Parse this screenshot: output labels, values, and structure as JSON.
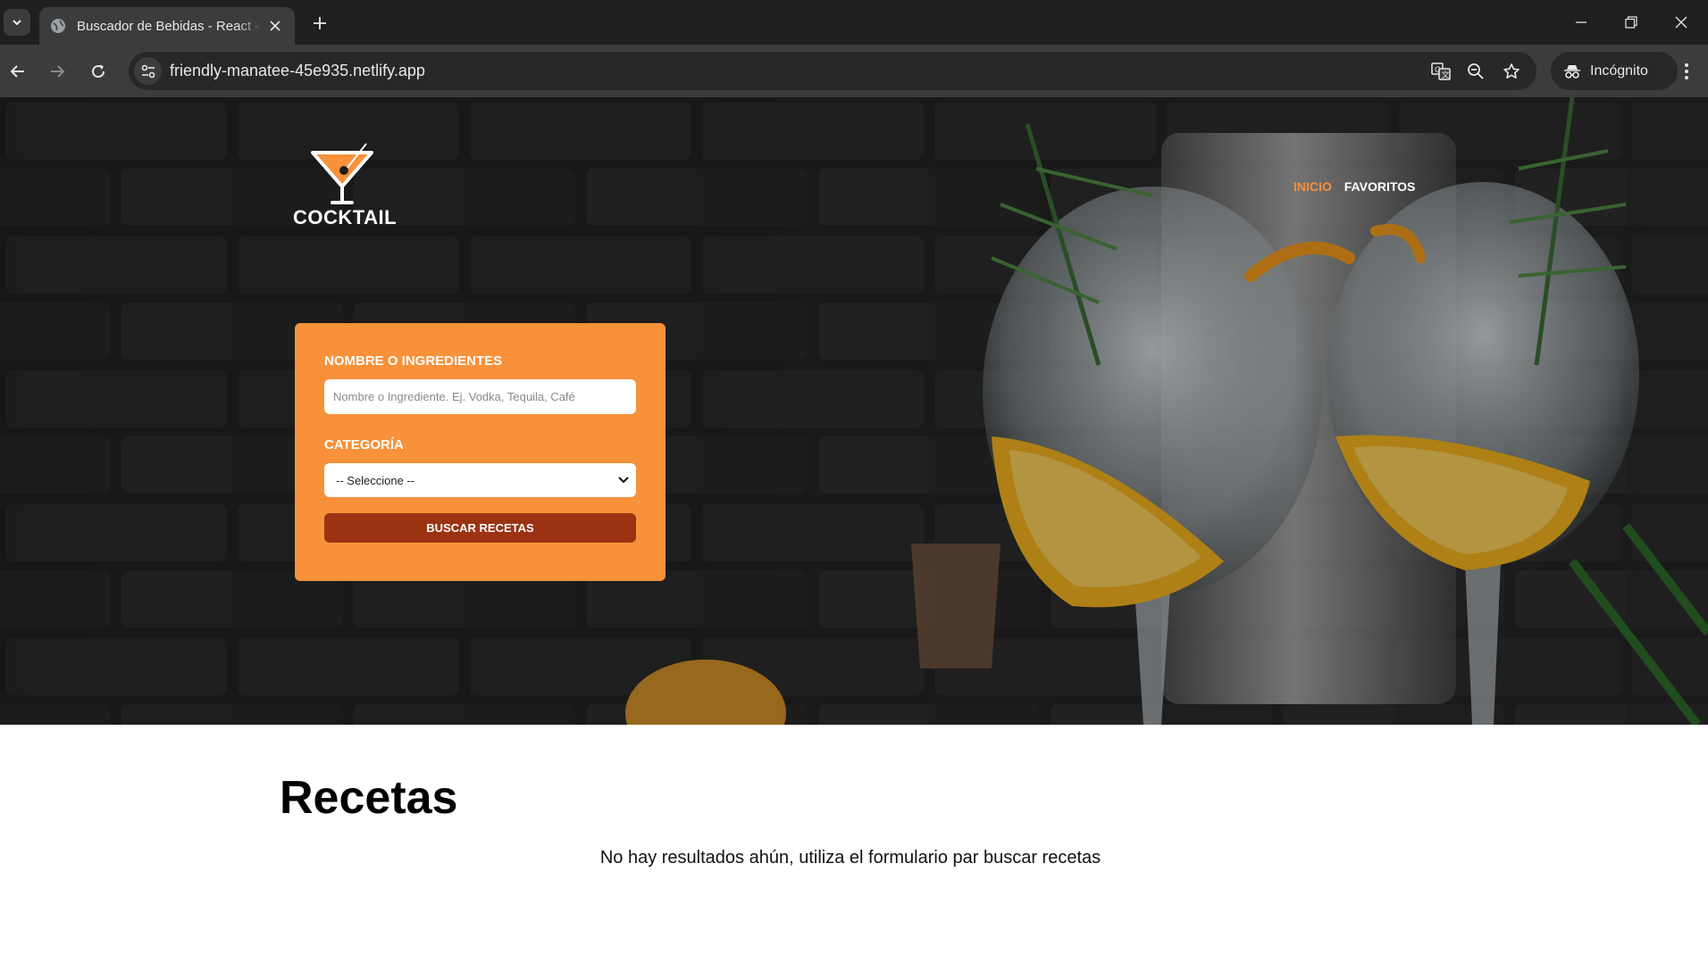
{
  "browser": {
    "tab_title": "Buscador de Bebidas - React - T",
    "url": "friendly-manatee-45e935.netlify.app",
    "incognito_label": "Incógnito",
    "icons": [
      "tab-search-icon",
      "globe-icon",
      "close-icon",
      "plus-icon",
      "minimize-icon",
      "restore-icon",
      "close-window-icon",
      "back-icon",
      "forward-icon",
      "reload-icon",
      "site-info-icon",
      "translate-icon",
      "zoom-out-icon",
      "star-icon",
      "incognito-icon",
      "kebab-menu-icon"
    ]
  },
  "header": {
    "logo_text": "COCKTAIL",
    "nav": [
      {
        "label": "INICIO",
        "active": true
      },
      {
        "label": "FAVORITOS",
        "active": false
      }
    ]
  },
  "form": {
    "name_label": "NOMBRE O INGREDIENTES",
    "name_placeholder": "Nombre o Ingrediente. Ej. Vodka, Tequila, Café",
    "name_value": "",
    "category_label": "CATEGORÍA",
    "category_selected": "-- Seleccione --",
    "submit_label": "BUSCAR RECETAS"
  },
  "content": {
    "title": "Recetas",
    "empty_message": "No hay resultados ahún, utiliza el formulario par buscar recetas"
  },
  "colors": {
    "accent": "#f7913a",
    "button": "#9b3313",
    "chrome_dark": "#1f1f1f",
    "chrome_toolbar": "#3c3c3c"
  }
}
